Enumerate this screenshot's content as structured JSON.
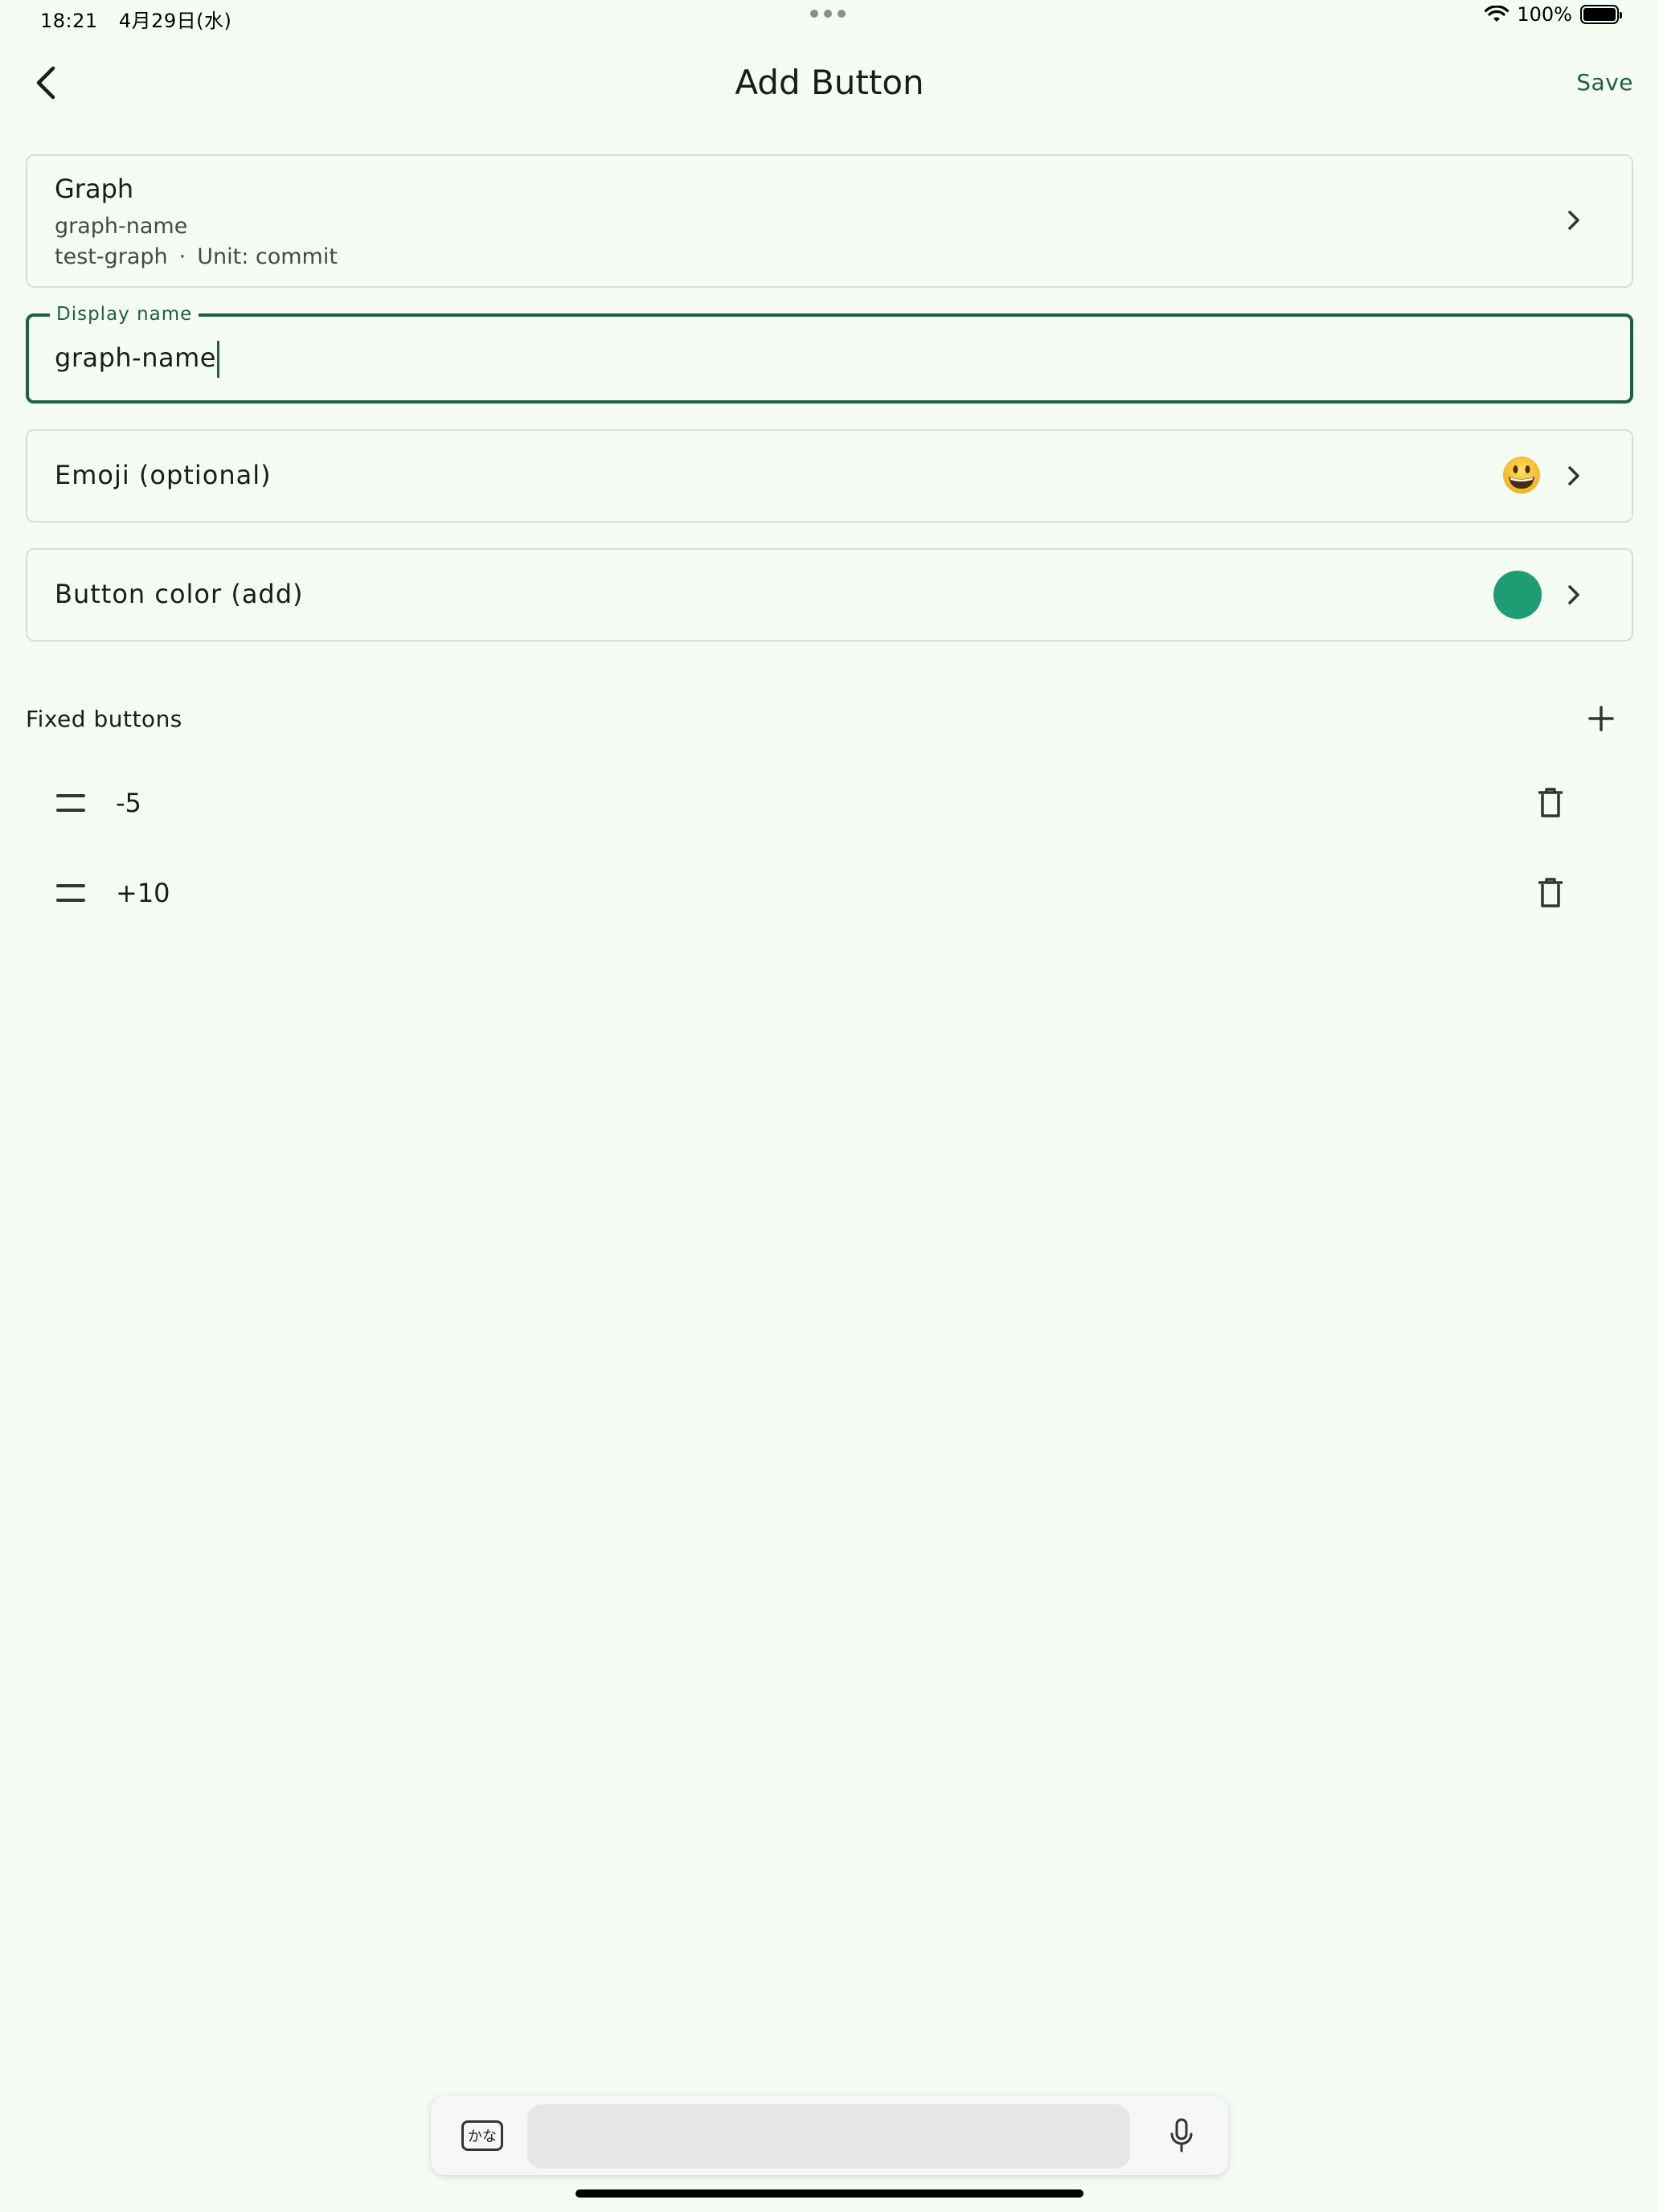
{
  "status_bar": {
    "time": "18:21",
    "date": "4月29日(水)",
    "battery": "100%"
  },
  "header": {
    "title": "Add Button",
    "save_label": "Save"
  },
  "graph_card": {
    "title": "Graph",
    "graph_name": "graph-name",
    "graph_id": "test-graph",
    "separator": "·",
    "unit": "Unit: commit"
  },
  "display_name": {
    "label": "Display name",
    "value": "graph-name"
  },
  "emoji_row": {
    "label": "Emoji (optional)",
    "emoji": "😀"
  },
  "color_row": {
    "label": "Button color (add)",
    "color": "#1e9c74"
  },
  "fixed_buttons": {
    "title": "Fixed buttons",
    "items": [
      {
        "value": "-5"
      },
      {
        "value": "+10"
      }
    ]
  },
  "keyboard_bar": {
    "kana_label": "かな"
  },
  "colors": {
    "accent": "#1f5f43",
    "background": "#f4fcf4",
    "button_color": "#1e9c74"
  }
}
